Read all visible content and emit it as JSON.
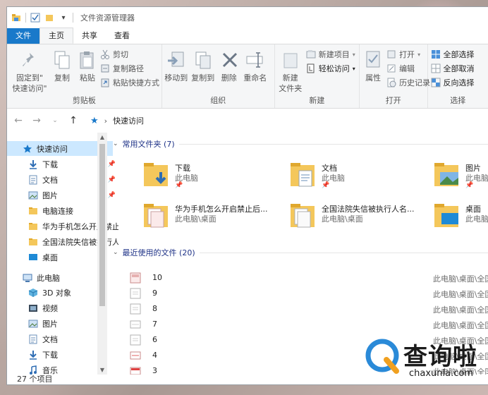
{
  "window": {
    "title": "文件资源管理器",
    "qat_dropdown": "▾"
  },
  "tabs": [
    {
      "label": "文件"
    },
    {
      "label": "主页"
    },
    {
      "label": "共享"
    },
    {
      "label": "查看"
    }
  ],
  "ribbon": {
    "clipboard": {
      "label": "剪贴板",
      "pin_label_1": "固定到\"",
      "pin_label_2": "快速访问\"",
      "copy": "复制",
      "paste": "粘贴",
      "cut": "剪切",
      "copy_path": "复制路径",
      "paste_shortcut": "粘贴快捷方式"
    },
    "organize": {
      "label": "组织",
      "move_to": "移动到",
      "copy_to": "复制到",
      "delete": "删除",
      "rename": "重命名"
    },
    "new": {
      "label": "新建",
      "new_folder_1": "新建",
      "new_folder_2": "文件夹",
      "new_item": "新建项目",
      "easy_access": "轻松访问"
    },
    "open": {
      "label": "打开",
      "properties": "属性",
      "open": "打开",
      "edit": "编辑",
      "history": "历史记录"
    },
    "select": {
      "label": "选择",
      "select_all": "全部选择",
      "select_none": "全部取消",
      "invert": "反向选择"
    }
  },
  "address": {
    "path": "快速访问",
    "separator": "›"
  },
  "sidebar": {
    "items": [
      {
        "label": "快速访问",
        "icon": "star-icon"
      },
      {
        "label": "下载",
        "icon": "download-icon",
        "pinned": true
      },
      {
        "label": "文档",
        "icon": "document-icon",
        "pinned": true
      },
      {
        "label": "图片",
        "icon": "picture-icon",
        "pinned": true
      },
      {
        "label": "电脑连接",
        "icon": "folder-icon"
      },
      {
        "label": "华为手机怎么开启禁止后台",
        "icon": "folder-icon"
      },
      {
        "label": "全国法院失信被执行人名单",
        "icon": "folder-icon"
      },
      {
        "label": "桌面",
        "icon": "desktop-icon"
      },
      {
        "label": "此电脑",
        "icon": "computer-icon"
      },
      {
        "label": "3D 对象",
        "icon": "cube-icon"
      },
      {
        "label": "视频",
        "icon": "video-icon"
      },
      {
        "label": "图片",
        "icon": "picture-icon"
      },
      {
        "label": "文档",
        "icon": "document-icon"
      },
      {
        "label": "下载",
        "icon": "download-icon"
      },
      {
        "label": "音乐",
        "icon": "music-icon"
      }
    ]
  },
  "frequent": {
    "header": "常用文件夹 (7)",
    "tiles": [
      {
        "name": "下载",
        "sub": "此电脑",
        "pinned": true
      },
      {
        "name": "文档",
        "sub": "此电脑",
        "pinned": true
      },
      {
        "name": "图片",
        "sub": "此电脑",
        "pinned": true
      },
      {
        "name": "华为手机怎么开启禁止后...",
        "sub": "此电脑\\桌面"
      },
      {
        "name": "全国法院失信被执行人名...",
        "sub": "此电脑\\桌面"
      },
      {
        "name": "桌面",
        "sub": "此电脑"
      }
    ]
  },
  "recent": {
    "header": "最近使用的文件 (20)",
    "items": [
      {
        "name": "10",
        "location": "此电脑\\桌面\\全国"
      },
      {
        "name": "9",
        "location": "此电脑\\桌面\\全国"
      },
      {
        "name": "8",
        "location": "此电脑\\桌面\\全国"
      },
      {
        "name": "7",
        "location": "此电脑\\桌面\\全国"
      },
      {
        "name": "6",
        "location": "此电脑\\桌面\\全国"
      },
      {
        "name": "4",
        "location": "此电脑\\桌面\\全国"
      },
      {
        "name": "3",
        "location": "此电脑\\桌面\\全国"
      }
    ]
  },
  "status": {
    "count": "27 个项目"
  },
  "watermark": {
    "text": "查询啦",
    "url": "chaxunla.com"
  },
  "colors": {
    "accent": "#1979ca",
    "selection": "#cce8ff",
    "folder": "#f4c75b",
    "header_text": "#1e3287"
  }
}
